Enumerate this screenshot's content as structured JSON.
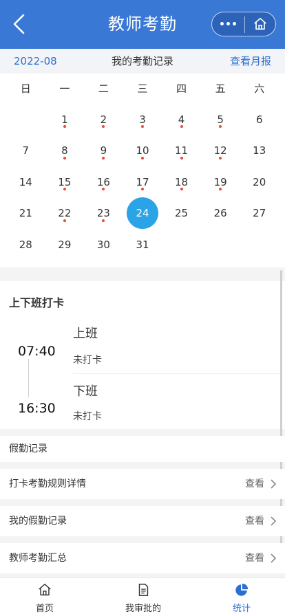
{
  "header": {
    "title": "教师考勤"
  },
  "calendar": {
    "month": "2022-08",
    "center_title": "我的考勤记录",
    "report_link": "查看月报",
    "weekdays": [
      "日",
      "一",
      "二",
      "三",
      "四",
      "五",
      "六"
    ],
    "leading_blanks": 1,
    "days": [
      {
        "n": "1",
        "dot": true
      },
      {
        "n": "2",
        "dot": true
      },
      {
        "n": "3",
        "dot": true
      },
      {
        "n": "4",
        "dot": true
      },
      {
        "n": "5",
        "dot": true
      },
      {
        "n": "6",
        "dot": false
      },
      {
        "n": "7",
        "dot": false
      },
      {
        "n": "8",
        "dot": true
      },
      {
        "n": "9",
        "dot": true
      },
      {
        "n": "10",
        "dot": true
      },
      {
        "n": "11",
        "dot": true
      },
      {
        "n": "12",
        "dot": true
      },
      {
        "n": "13",
        "dot": false
      },
      {
        "n": "14",
        "dot": false
      },
      {
        "n": "15",
        "dot": true
      },
      {
        "n": "16",
        "dot": true
      },
      {
        "n": "17",
        "dot": true
      },
      {
        "n": "18",
        "dot": true
      },
      {
        "n": "19",
        "dot": true
      },
      {
        "n": "20",
        "dot": false
      },
      {
        "n": "21",
        "dot": false
      },
      {
        "n": "22",
        "dot": true
      },
      {
        "n": "23",
        "dot": true
      },
      {
        "n": "24",
        "dot": false,
        "selected": true
      },
      {
        "n": "25",
        "dot": false
      },
      {
        "n": "26",
        "dot": false
      },
      {
        "n": "27",
        "dot": false
      },
      {
        "n": "28",
        "dot": false
      },
      {
        "n": "29",
        "dot": false
      },
      {
        "n": "30",
        "dot": false
      },
      {
        "n": "31",
        "dot": false
      }
    ],
    "dot_color": "#e84a3c",
    "selected_color": "#2aa4e6"
  },
  "punch": {
    "title": "上下班打卡",
    "on_time": "07:40",
    "on_label": "上班",
    "on_status": "未打卡",
    "off_time": "16:30",
    "off_label": "下班",
    "off_status": "未打卡"
  },
  "records": {
    "section_title": "假勤记录",
    "rows": [
      {
        "label": "打卡考勤规则详情",
        "action": "查看"
      },
      {
        "label": "我的假勤记录",
        "action": "查看"
      },
      {
        "label": "教师考勤汇总",
        "action": "查看"
      }
    ]
  },
  "tabs": [
    {
      "label": "首页",
      "icon": "home-icon"
    },
    {
      "label": "我审批的",
      "icon": "document-icon"
    },
    {
      "label": "统计",
      "icon": "pie-chart-icon",
      "active": true
    }
  ],
  "colors": {
    "header": "#3a78d6",
    "accent": "#2b6fd1"
  }
}
